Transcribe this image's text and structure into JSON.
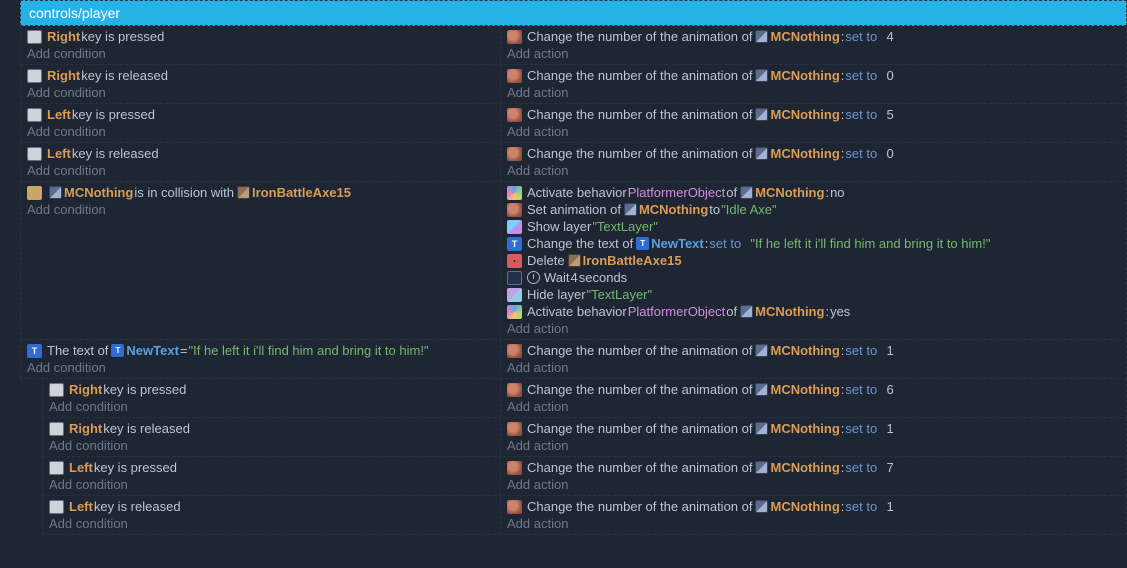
{
  "groupTitle": "controls/player",
  "addCondition": "Add condition",
  "addAction": "Add action",
  "keys": {
    "right": "Right",
    "left": "Left"
  },
  "txt": {
    "pressed": " key is pressed",
    "released": " key is released",
    "changeAnim": "Change the number of the animation of ",
    "collision1": " is in collision with ",
    "activateBeh": "Activate behavior ",
    "of": " of ",
    "to": " to ",
    "setAnim": "Set animation of ",
    "showLayer": "Show layer ",
    "hideLayer": "Hide layer ",
    "changeText": "Change the text of ",
    "delete": "Delete ",
    "wait1": "Wait ",
    "wait2": " seconds",
    "theTextOf": "The text of ",
    "eq": " = "
  },
  "objs": {
    "mc": "MCNothing",
    "axe": "IronBattleAxe15",
    "newText": "NewText",
    "platformer": "PlatformerObject"
  },
  "vals": {
    "setTo": "set to",
    "n4": "4",
    "n0": "0",
    "n5": "5",
    "n1": "1",
    "n6": "6",
    "n7": "7",
    "no": "no",
    "yes": "yes",
    "idleAxe": "\"Idle Axe\"",
    "textLayer": "\"TextLayer\"",
    "quote": "\"If he left it i'll find him and bring it to him!\"",
    "waitN": "4"
  },
  "punc": {
    "colon": ":",
    "colonSp": ": "
  }
}
